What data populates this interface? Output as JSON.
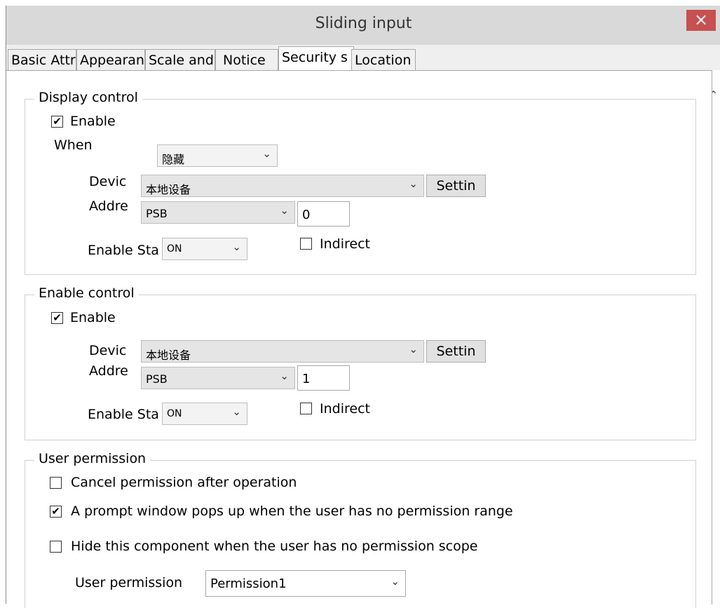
{
  "window": {
    "title": "Sliding input",
    "close_symbol": "×"
  },
  "tabs": [
    {
      "label": "Basic Attri"
    },
    {
      "label": "Appearan"
    },
    {
      "label": "Scale and"
    },
    {
      "label": "Notice"
    },
    {
      "label": "Security s"
    },
    {
      "label": "Location"
    }
  ],
  "display_control": {
    "legend": "Display control",
    "enable_label": "Enable",
    "enable_checked": true,
    "when_label": "When",
    "when_value": "隐藏",
    "device_label": "Devic",
    "device_value": "本地设备",
    "settings_label": "Settin",
    "address_label": "Addre",
    "address_type": "PSB",
    "address_value": "0",
    "enable_state_label": "Enable Sta",
    "enable_state_value": "ON",
    "indirect_label": "Indirect",
    "indirect_checked": false
  },
  "enable_control": {
    "legend": "Enable control",
    "enable_label": "Enable",
    "enable_checked": true,
    "device_label": "Devic",
    "device_value": "本地设备",
    "settings_label": "Settin",
    "address_label": "Addre",
    "address_type": "PSB",
    "address_value": "1",
    "enable_state_label": "Enable Sta",
    "enable_state_value": "ON",
    "indirect_label": "Indirect",
    "indirect_checked": false
  },
  "user_permission": {
    "legend": "User permission",
    "options": [
      {
        "label": "Cancel permission after operation",
        "checked": false
      },
      {
        "label": "A prompt window pops up when the user has no permission range",
        "checked": true
      },
      {
        "label": "Hide this component when the user has no permission scope",
        "checked": false
      }
    ],
    "select_label": "User permission",
    "select_value": "Permission1"
  },
  "icons": {
    "chevron": "chevron-down-icon",
    "check": "checkmark-icon",
    "close": "close-icon",
    "scroll": "scroll-up-icon"
  }
}
